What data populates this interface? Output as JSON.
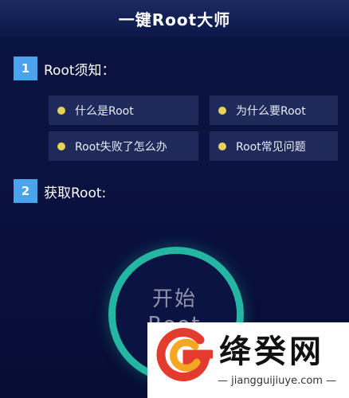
{
  "header": {
    "title": "一键Root大师"
  },
  "section1": {
    "number": "1",
    "label": "Root须知：",
    "items": [
      {
        "label": "什么是Root"
      },
      {
        "label": "为什么要Root"
      },
      {
        "label": "Root失败了怎么办"
      },
      {
        "label": "Root常见问题"
      }
    ]
  },
  "section2": {
    "number": "2",
    "label": "获取Root:"
  },
  "start_button": {
    "line1": "开始",
    "line2": "Root"
  },
  "watermark": {
    "name": "绛癸网",
    "url": "— jiangguijiuye.com —"
  },
  "colors": {
    "background": "#0a1240",
    "accent": "#4aa3ec",
    "ring": "#24b5a3",
    "dot": "#e4d357",
    "card": "#1f2a5a"
  }
}
